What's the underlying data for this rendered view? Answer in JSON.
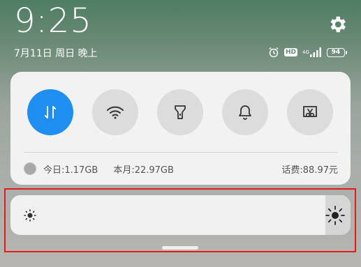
{
  "status_bar": {
    "time": "9:25",
    "date": "7月11日 周日 晚上",
    "network_type": "4G",
    "battery": "94"
  },
  "quick_settings": {
    "toggles": [
      {
        "icon": "mobile-data-icon",
        "active": true
      },
      {
        "icon": "wifi-icon",
        "active": false
      },
      {
        "icon": "flashlight-icon",
        "active": false
      },
      {
        "icon": "bell-icon",
        "active": false
      },
      {
        "icon": "screenshot-icon",
        "active": false
      }
    ],
    "usage": {
      "today": "今日:1.17GB",
      "month": "本月:22.97GB",
      "fee": "话费:88.97元"
    }
  },
  "brightness": {
    "level": 1.0
  },
  "colors": {
    "accent": "#1e8ef0",
    "highlight_box": "#e31b1b"
  }
}
